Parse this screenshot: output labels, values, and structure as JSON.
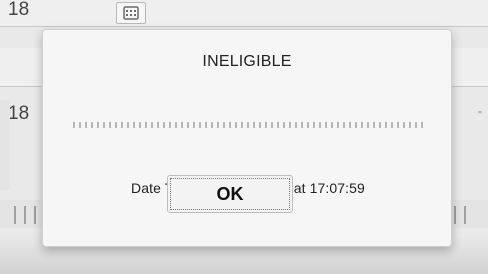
{
  "background": {
    "rows": [
      {
        "value": "18"
      },
      {
        "value": "18"
      }
    ],
    "icons": {
      "calendar": "calendar-icon"
    }
  },
  "dialog": {
    "title": "INELIGIBLE",
    "message": "Date Time: June 30 2018 at 17:07:59",
    "buttons": {
      "ok_label": "OK"
    }
  },
  "colors": {
    "dialog_bg": "#f6f6f6",
    "text": "#222222",
    "border": "#cfcfcf"
  }
}
